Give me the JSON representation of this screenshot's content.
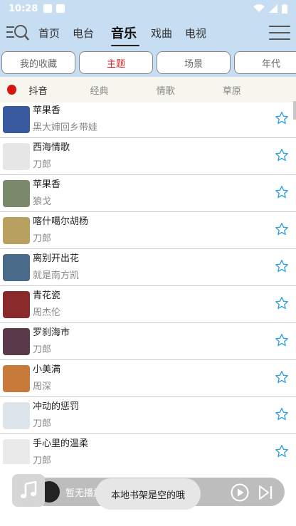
{
  "status_bar": {
    "time": "10:28"
  },
  "nav": {
    "tabs": [
      "首页",
      "电台",
      "音乐",
      "戏曲",
      "电视"
    ],
    "active_index": 2
  },
  "filters": {
    "chips": [
      "我的收藏",
      "主题",
      "场景",
      "年代"
    ],
    "active_index": 1
  },
  "sub_tabs": [
    "抖音",
    "经典",
    "情歌",
    "草原"
  ],
  "songs": [
    {
      "title": "苹果香",
      "artist": "黑大婶回乡带娃",
      "cover": "#3a5aa0"
    },
    {
      "title": "西海情歌",
      "artist": "刀郎",
      "cover": "#e6e6e6"
    },
    {
      "title": "苹果香",
      "artist": "狼戈",
      "cover": "#7a8a6a"
    },
    {
      "title": "喀什噶尔胡杨",
      "artist": "刀郎",
      "cover": "#b8a060"
    },
    {
      "title": "离别开出花",
      "artist": "就是南方凯",
      "cover": "#4a6a8a"
    },
    {
      "title": "青花瓷",
      "artist": "周杰伦",
      "cover": "#8a2a2a"
    },
    {
      "title": "罗刹海市",
      "artist": "刀郎",
      "cover": "#5a3a4a"
    },
    {
      "title": "小美满",
      "artist": "周深",
      "cover": "#c87a3a"
    },
    {
      "title": "冲动的惩罚",
      "artist": "刀郎",
      "cover": "#dde4ea"
    },
    {
      "title": "手心里的温柔",
      "artist": "刀郎",
      "cover": "#eaeaea"
    }
  ],
  "player": {
    "now_playing": "暂无播放歌曲"
  },
  "toast": {
    "message": "本地书架是空的哦"
  },
  "colors": {
    "accent_red": "#d8140d",
    "star_blue": "#2aa1e0",
    "header_bg": "#c7ddf1"
  },
  "icons": {
    "search": "search-icon",
    "menu": "menu-icon",
    "star": "star-icon",
    "play": "play-icon",
    "next": "next-icon",
    "music_note": "music-note-icon"
  }
}
